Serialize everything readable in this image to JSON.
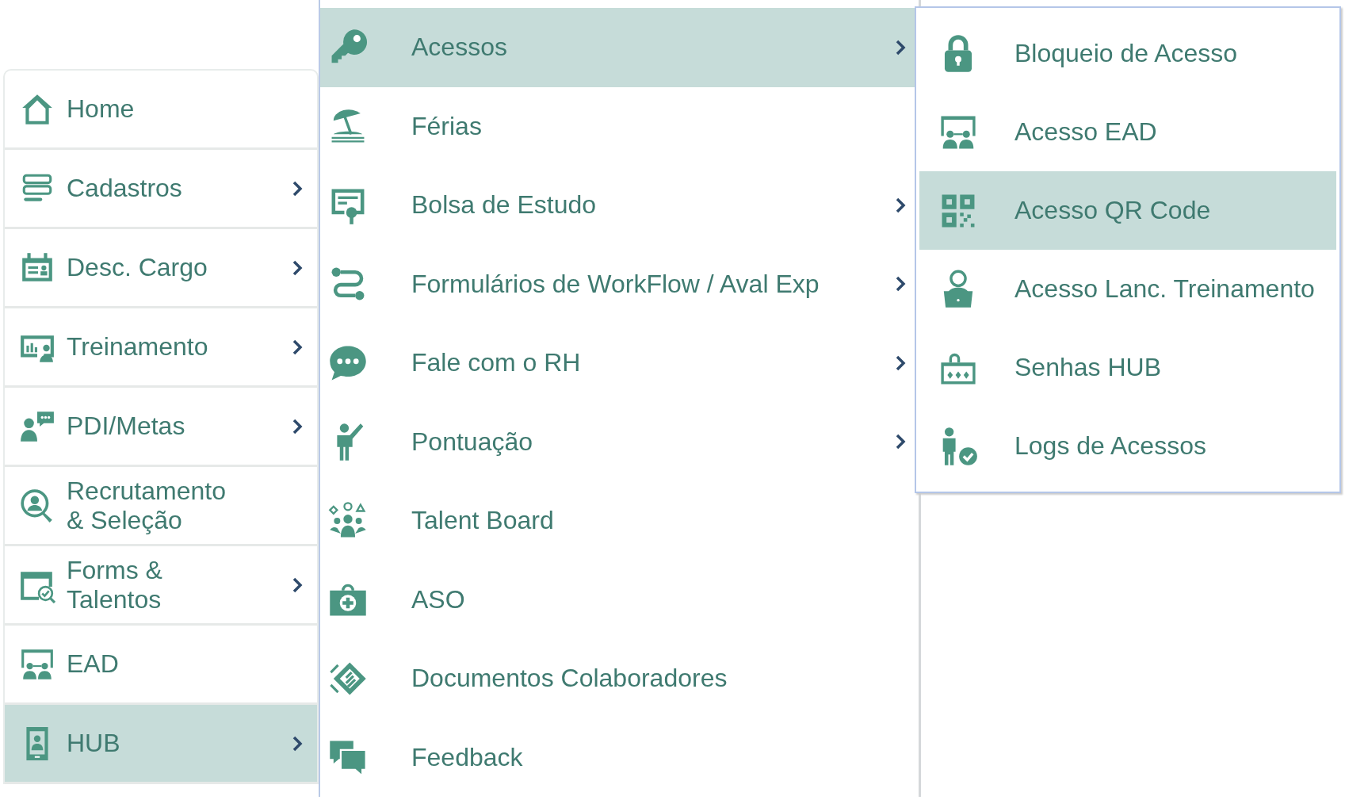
{
  "main_menu": [
    {
      "label": "Home",
      "submenu": false,
      "selected": false
    },
    {
      "label": "Cadastros",
      "submenu": true,
      "selected": false
    },
    {
      "label": "Desc. Cargo",
      "submenu": true,
      "selected": false
    },
    {
      "label": "Treinamento",
      "submenu": true,
      "selected": false
    },
    {
      "label": "PDI/Metas",
      "submenu": true,
      "selected": false
    },
    {
      "label": "Recrutamento & Seleção",
      "submenu": false,
      "selected": false
    },
    {
      "label": "Forms & Talentos",
      "submenu": true,
      "selected": false
    },
    {
      "label": "EAD",
      "submenu": false,
      "selected": false
    },
    {
      "label": "HUB",
      "submenu": true,
      "selected": true
    }
  ],
  "hub_menu": [
    {
      "label": "Acessos",
      "submenu": true,
      "selected": true
    },
    {
      "label": "Férias",
      "submenu": false,
      "selected": false
    },
    {
      "label": "Bolsa de Estudo",
      "submenu": true,
      "selected": false
    },
    {
      "label": "Formulários de WorkFlow / Aval Exp",
      "submenu": true,
      "selected": false
    },
    {
      "label": "Fale com o RH",
      "submenu": true,
      "selected": false
    },
    {
      "label": "Pontuação",
      "submenu": true,
      "selected": false
    },
    {
      "label": "Talent Board",
      "submenu": false,
      "selected": false
    },
    {
      "label": "ASO",
      "submenu": false,
      "selected": false
    },
    {
      "label": "Documentos Colaboradores",
      "submenu": false,
      "selected": false
    },
    {
      "label": "Feedback",
      "submenu": false,
      "selected": false
    }
  ],
  "acessos_menu": [
    {
      "label": "Bloqueio de Acesso",
      "selected": false
    },
    {
      "label": "Acesso EAD",
      "selected": false
    },
    {
      "label": "Acesso QR Code",
      "selected": true
    },
    {
      "label": "Acesso Lanc. Treinamento",
      "selected": false
    },
    {
      "label": "Senhas HUB",
      "selected": false
    },
    {
      "label": "Logs de Acessos",
      "selected": false
    }
  ]
}
